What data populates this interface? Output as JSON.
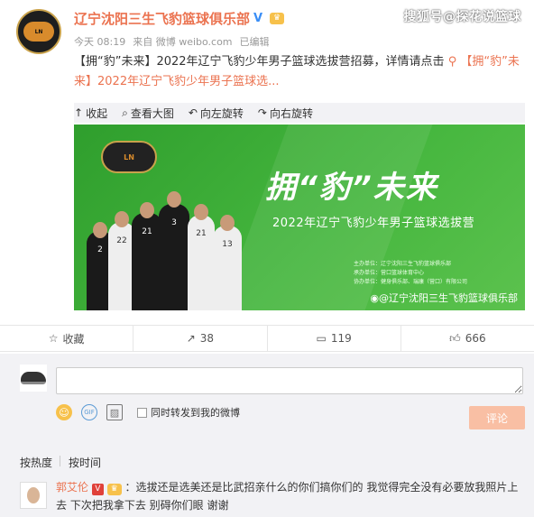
{
  "watermark": "搜狐号@探花说篮球",
  "post": {
    "author": "辽宁沈阳三生飞豹篮球俱乐部",
    "time": "今天 08:19",
    "source": "来自 微博 weibo.com",
    "edited": "已编辑",
    "text_main": "【拥“豹”未来】2022年辽宁飞豹少年男子篮球选拔营招募，详情请点击",
    "text_link": "【拥“豹”未来】2022年辽宁飞豹少年男子篮球选...",
    "toolbar": [
      "收起",
      "查看大图",
      "向左旋转",
      "向右旋转"
    ],
    "banner": {
      "slogan": "拥“豹”未来",
      "subtitle": "2022年辽宁飞豹少年男子篮球选拔营",
      "weibo_tag": "@辽宁沈阳三生飞豹篮球俱乐部",
      "small_lines": [
        "主办单位：辽宁沈阳三生飞豹篮球俱乐部",
        "承办单位：营口篮球体育中心",
        "协办单位：健身俱乐部、瑞康（营口）有限公司"
      ]
    }
  },
  "actions": {
    "favorite": "收藏",
    "repost": "38",
    "comment": "119",
    "like": "666"
  },
  "composer": {
    "placeholder": "",
    "checkbox_label": "同时转发到我的微博",
    "submit": "评论"
  },
  "sort": {
    "hot": "按热度",
    "time": "按时间"
  },
  "comment": {
    "user": "郭艾伦",
    "text": "：选拔还是选美还是比武招亲什么的你们搞你们的 我觉得完全没有必要放我照片上去 下次把我拿下去 别碍你们眼 谢谢"
  },
  "colors": {
    "accent": "#eb7350",
    "banner_green": "#45b63e",
    "button": "#f9bfa4"
  }
}
